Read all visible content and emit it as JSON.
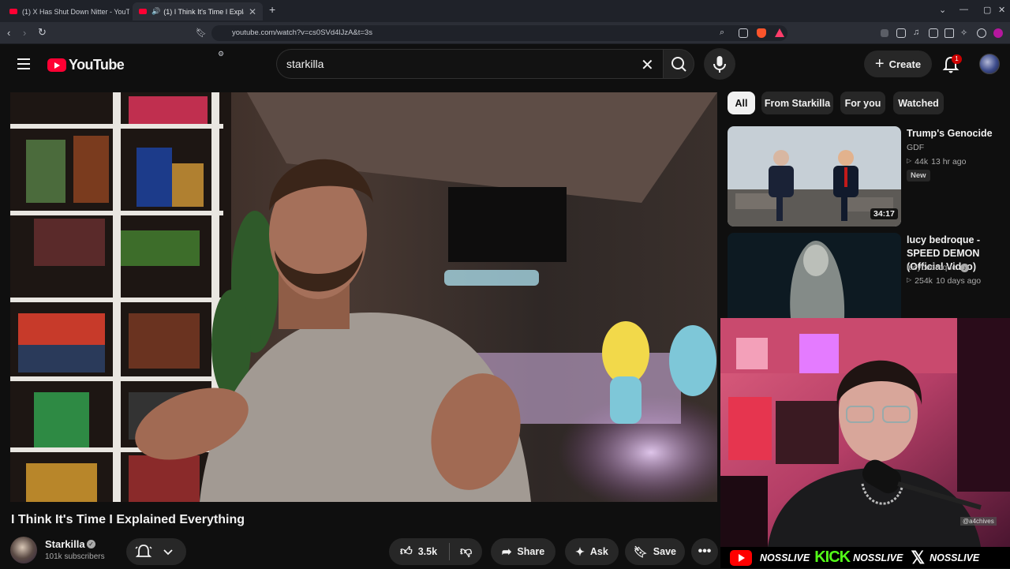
{
  "browser": {
    "tabs": [
      {
        "label": "(1) X Has Shut Down Nitter - YouTub",
        "active": false
      },
      {
        "label": "(1) I Think It's Time I Explaine",
        "active": true
      }
    ],
    "new_tab": "+",
    "url": "youtube.com/watch?v=cs0SVd4lJzA&t=3s"
  },
  "header": {
    "logo_text": "YouTube",
    "search_value": "starkilla",
    "create_label": "Create",
    "notification_count": "1"
  },
  "video": {
    "title": "I Think It's Time I Explained Everything",
    "channel": "Starkilla",
    "subscribers": "101k subscribers",
    "likes": "3.5k",
    "share_label": "Share",
    "ask_label": "Ask",
    "save_label": "Save"
  },
  "sidebar": {
    "chips": [
      "All",
      "From Starkilla",
      "For you",
      "Watched"
    ],
    "recommendations": [
      {
        "title": "Trump's Genocide",
        "channel": "GDF",
        "views": "44k",
        "age": "13 hr ago",
        "badge": "New",
        "duration": "34:17"
      },
      {
        "title": "lucy bedroque - SPEED DEMON (Official Video)",
        "channel": "lucybedroque",
        "views": "254k",
        "age": "10 days ago"
      }
    ]
  },
  "overlay": {
    "cam_tag": "@a4chives",
    "stream_handles": [
      "NOSSLIVE",
      "NOSSLIVE",
      "NOSSLIVE"
    ],
    "kick_label": "KICK"
  },
  "colors": {
    "accent": "#ff0033",
    "kick": "#53fc18"
  }
}
